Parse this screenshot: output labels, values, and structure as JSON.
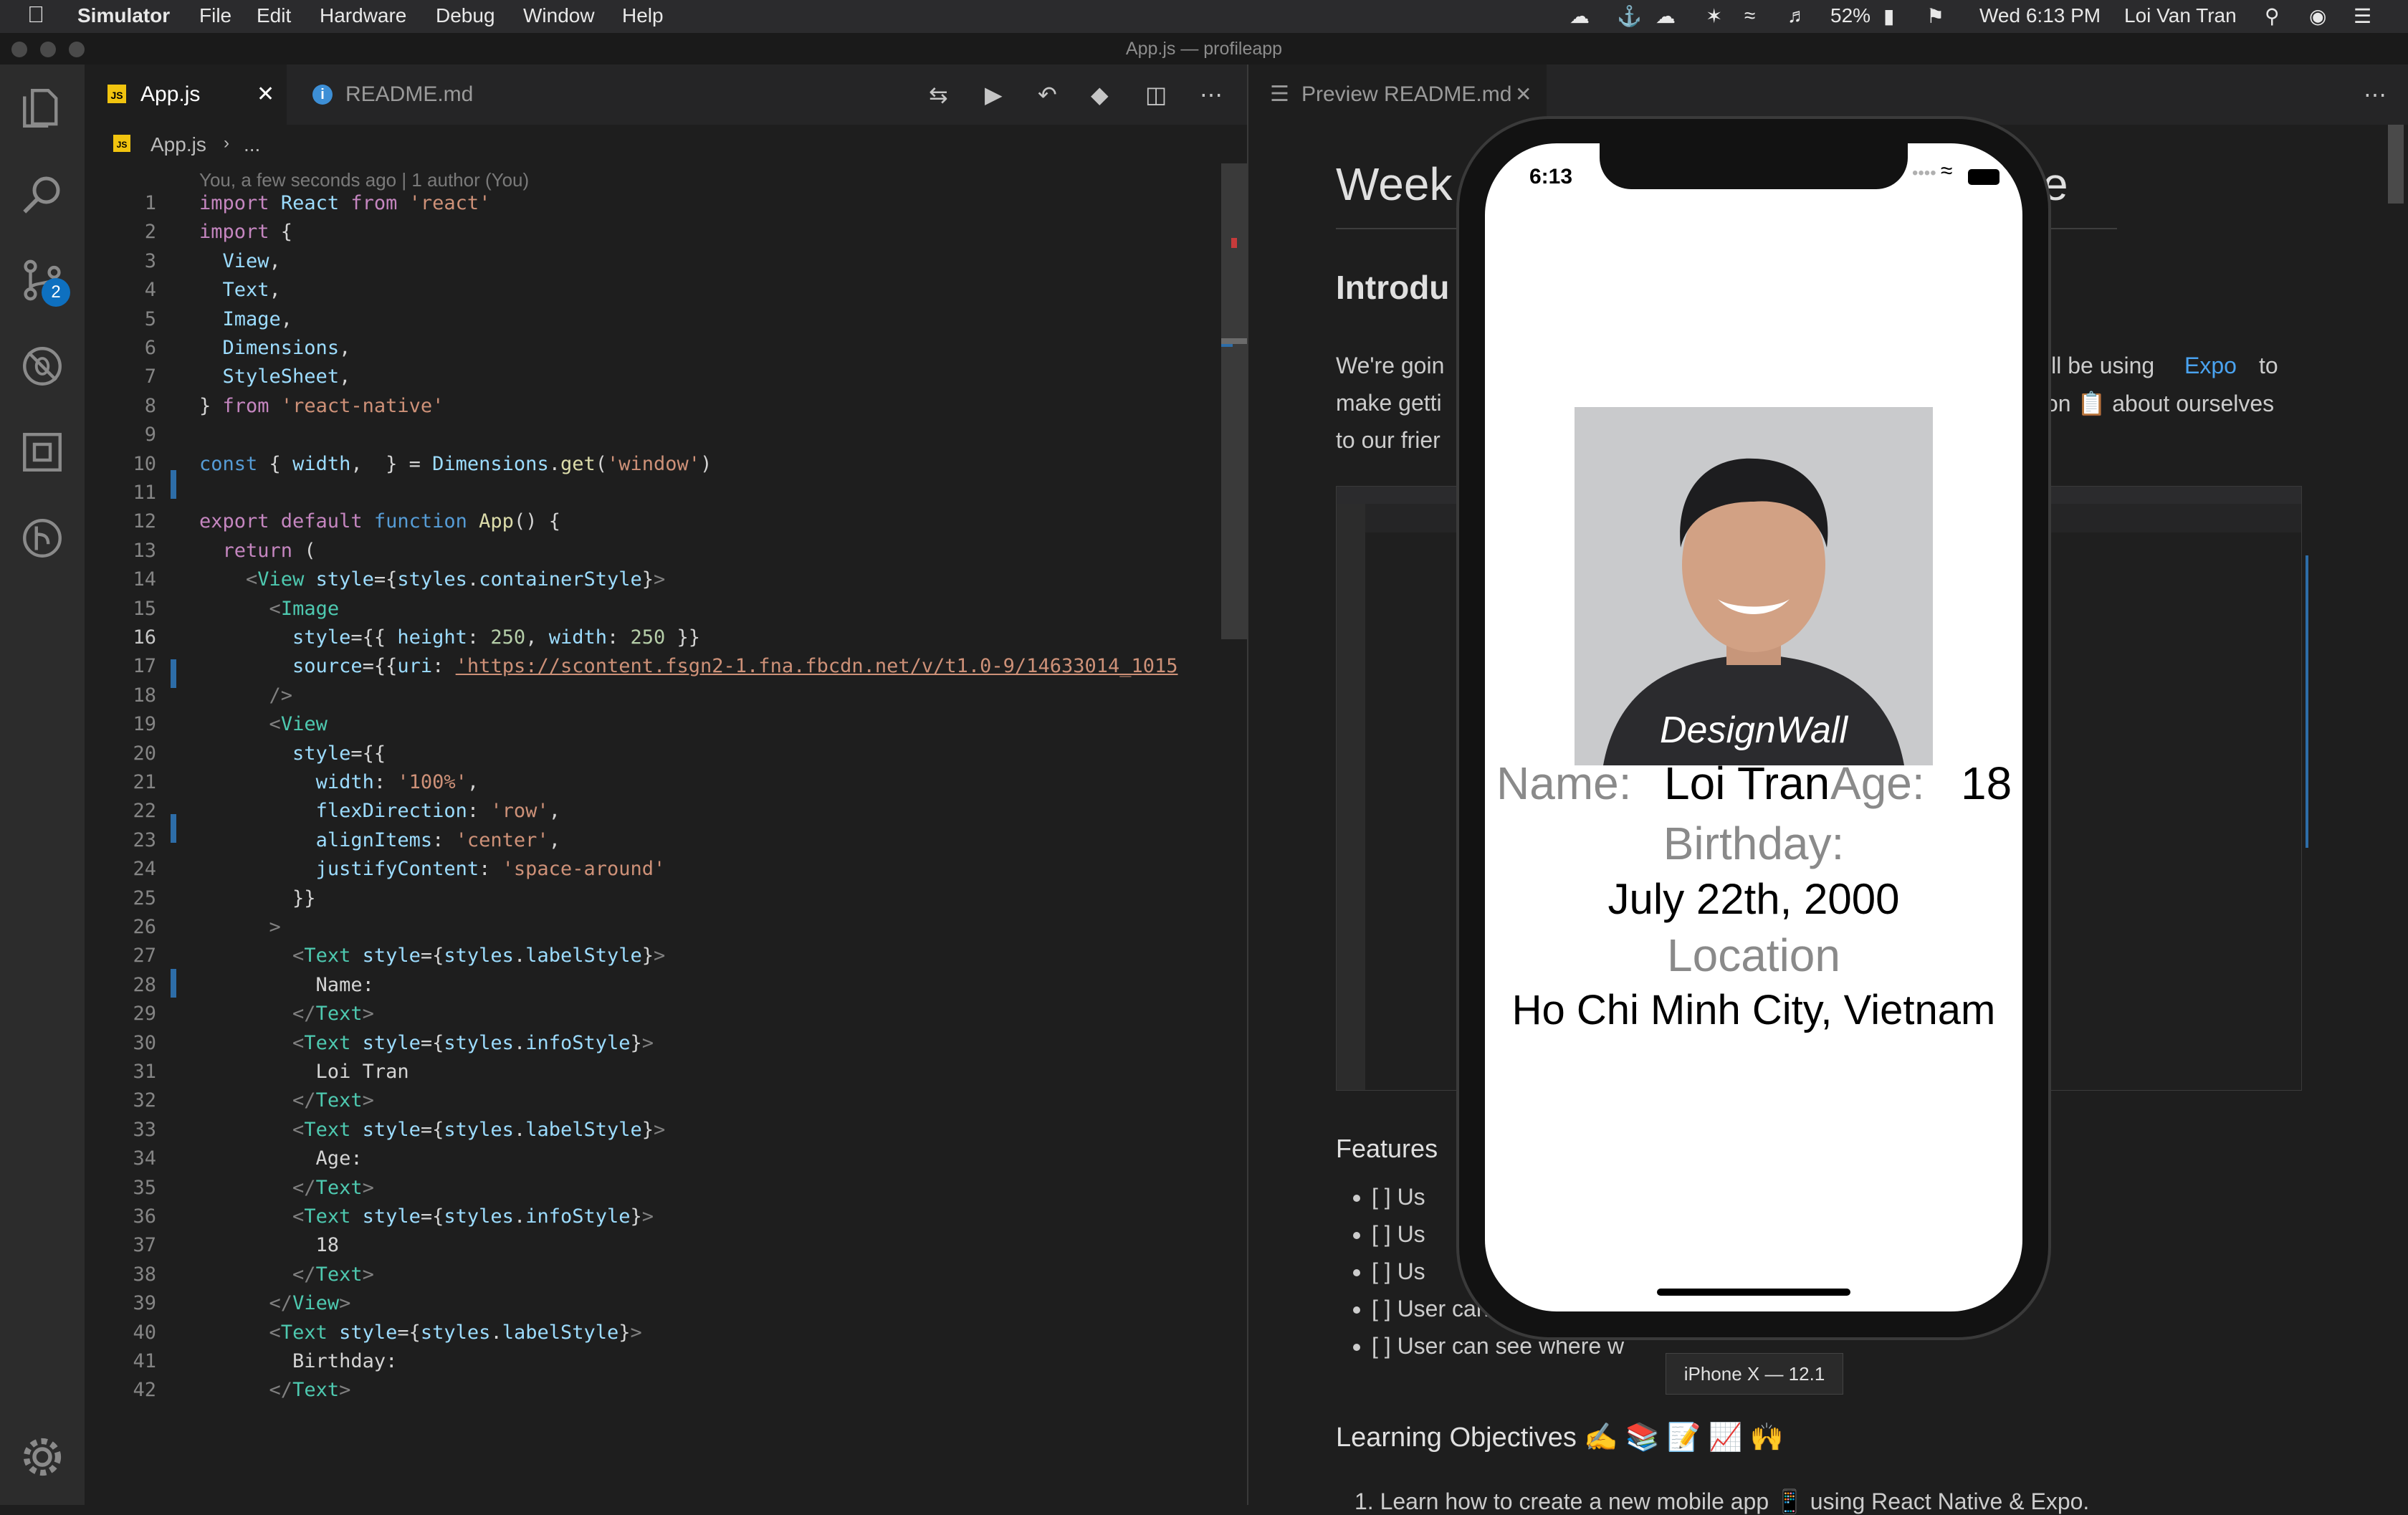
{
  "menubar": {
    "app": "Simulator",
    "items": [
      "File",
      "Edit",
      "Hardware",
      "Debug",
      "Window",
      "Help"
    ],
    "battery": "52%",
    "clock": "Wed 6:13 PM",
    "user": "Loi Van Tran"
  },
  "window_title": "App.js — profileapp",
  "activity": {
    "scm_badge": "2"
  },
  "editor": {
    "tabs": [
      {
        "label": "App.js",
        "active": true
      },
      {
        "label": "README.md",
        "active": false
      }
    ],
    "breadcrumb": {
      "file": "App.js",
      "rest": "..."
    },
    "blame": "You, a few seconds ago | 1 author (You)",
    "lines": [
      {
        "n": "1",
        "html": "<span class='k'>import</span> <span class='v'>React</span> <span class='k'>from</span> <span class='s'>'react'</span>"
      },
      {
        "n": "2",
        "html": "<span class='k'>import</span> {"
      },
      {
        "n": "3",
        "html": "  <span class='v'>View</span>,"
      },
      {
        "n": "4",
        "html": "  <span class='v'>Text</span>,"
      },
      {
        "n": "5",
        "html": "  <span class='v'>Image</span>,"
      },
      {
        "n": "6",
        "html": "  <span class='v'>Dimensions</span>,"
      },
      {
        "n": "7",
        "html": "  <span class='v'>StyleSheet</span>,"
      },
      {
        "n": "8",
        "html": "} <span class='k'>from</span> <span class='s'>'react-native'</span>"
      },
      {
        "n": "9",
        "html": ""
      },
      {
        "n": "10",
        "html": "<span class='b'>const</span> { <span class='v'>width</span>,  } = <span class='v'>Dimensions</span>.<span class='f'>get</span>(<span class='s'>'window'</span>)"
      },
      {
        "n": "11",
        "html": ""
      },
      {
        "n": "12",
        "html": "<span class='k'>export default</span> <span class='b'>function</span> <span class='f'>App</span>() {"
      },
      {
        "n": "13",
        "html": "  <span class='k'>return</span> ("
      },
      {
        "n": "14",
        "html": "    <span class='g'>&lt;</span><span class='t'>View</span> <span class='v'>style</span>={<span class='v'>styles</span>.<span class='v'>containerStyle</span>}<span class='g'>&gt;</span>"
      },
      {
        "n": "15",
        "html": "      <span class='g'>&lt;</span><span class='t'>Image</span>"
      },
      {
        "n": "16",
        "html": "        <span class='v'>style</span>={{ <span class='v'>height</span>: <span class='n'>250</span>, <span class='v'>width</span>: <span class='n'>250</span> }}"
      },
      {
        "n": "17",
        "html": "        <span class='v'>source</span>={{<span class='v'>uri</span>: <span class='s' style='text-decoration:underline'>'https://scontent.fsgn2-1.fna.fbcdn.net/v/t1.0-9/14633014_1015</span>"
      },
      {
        "n": "18",
        "html": "      <span class='g'>/&gt;</span>"
      },
      {
        "n": "19",
        "html": "      <span class='g'>&lt;</span><span class='t'>View</span>"
      },
      {
        "n": "20",
        "html": "        <span class='v'>style</span>={{"
      },
      {
        "n": "21",
        "html": "          <span class='v'>width</span>: <span class='s'>'100%'</span>,"
      },
      {
        "n": "22",
        "html": "          <span class='v'>flexDirection</span>: <span class='s'>'row'</span>,"
      },
      {
        "n": "23",
        "html": "          <span class='v'>alignItems</span>: <span class='s'>'center'</span>,"
      },
      {
        "n": "24",
        "html": "          <span class='v'>justifyContent</span>: <span class='s'>'space-around'</span>"
      },
      {
        "n": "25",
        "html": "        }}"
      },
      {
        "n": "26",
        "html": "      <span class='g'>&gt;</span>"
      },
      {
        "n": "27",
        "html": "        <span class='g'>&lt;</span><span class='t'>Text</span> <span class='v'>style</span>={<span class='v'>styles</span>.<span class='v'>labelStyle</span>}<span class='g'>&gt;</span>"
      },
      {
        "n": "28",
        "html": "          Name:"
      },
      {
        "n": "29",
        "html": "        <span class='g'>&lt;/</span><span class='t'>Text</span><span class='g'>&gt;</span>"
      },
      {
        "n": "30",
        "html": "        <span class='g'>&lt;</span><span class='t'>Text</span> <span class='v'>style</span>={<span class='v'>styles</span>.<span class='v'>infoStyle</span>}<span class='g'>&gt;</span>"
      },
      {
        "n": "31",
        "html": "          Loi Tran"
      },
      {
        "n": "32",
        "html": "        <span class='g'>&lt;/</span><span class='t'>Text</span><span class='g'>&gt;</span>"
      },
      {
        "n": "33",
        "html": "        <span class='g'>&lt;</span><span class='t'>Text</span> <span class='v'>style</span>={<span class='v'>styles</span>.<span class='v'>labelStyle</span>}<span class='g'>&gt;</span>"
      },
      {
        "n": "34",
        "html": "          Age:"
      },
      {
        "n": "35",
        "html": "        <span class='g'>&lt;/</span><span class='t'>Text</span><span class='g'>&gt;</span>"
      },
      {
        "n": "36",
        "html": "        <span class='g'>&lt;</span><span class='t'>Text</span> <span class='v'>style</span>={<span class='v'>styles</span>.<span class='v'>infoStyle</span>}<span class='g'>&gt;</span>"
      },
      {
        "n": "37",
        "html": "          18"
      },
      {
        "n": "38",
        "html": "        <span class='g'>&lt;/</span><span class='t'>Text</span><span class='g'>&gt;</span>"
      },
      {
        "n": "39",
        "html": "      <span class='g'>&lt;/</span><span class='t'>View</span><span class='g'>&gt;</span>"
      },
      {
        "n": "40",
        "html": "      <span class='g'>&lt;</span><span class='t'>Text</span> <span class='v'>style</span>={<span class='v'>styles</span>.<span class='v'>labelStyle</span>}<span class='g'>&gt;</span>"
      },
      {
        "n": "41",
        "html": "        Birthday:"
      },
      {
        "n": "42",
        "html": "      <span class='g'>&lt;/</span><span class='t'>Text</span><span class='g'>&gt;</span>"
      }
    ]
  },
  "preview": {
    "tab": "Preview README.md",
    "heading": "Week",
    "heading_tail": "e",
    "subheading": "Introdu",
    "para": [
      "We're goin",
      "'ll be using",
      "Expo",
      "to",
      "make getti",
      "on 📋 about ourselves",
      "to our frier"
    ],
    "features": "Features",
    "feature_items": [
      "[ ] Us",
      "[ ] Us",
      "[ ] Us",
      "[ ] User can see the profile picture",
      "[ ] User can see where w"
    ],
    "learning": "Learning Objectives ✍️ 📚 📝 📈 🙌",
    "learning_item": "1. Learn how to create a new mobile app 📱 using React Native & Expo."
  },
  "simulator": {
    "time": "6:13",
    "device_label": "iPhone X — 12.1",
    "avatar_text": "DesignWall",
    "name_label": "Name:",
    "name_value": "Loi Tran",
    "age_label": "Age:",
    "age_value": "18",
    "birthday_label": "Birthday:",
    "birthday_value": "July 22th, 2000",
    "location_label": "Location",
    "location_value": "Ho Chi Minh City, Vietnam"
  }
}
